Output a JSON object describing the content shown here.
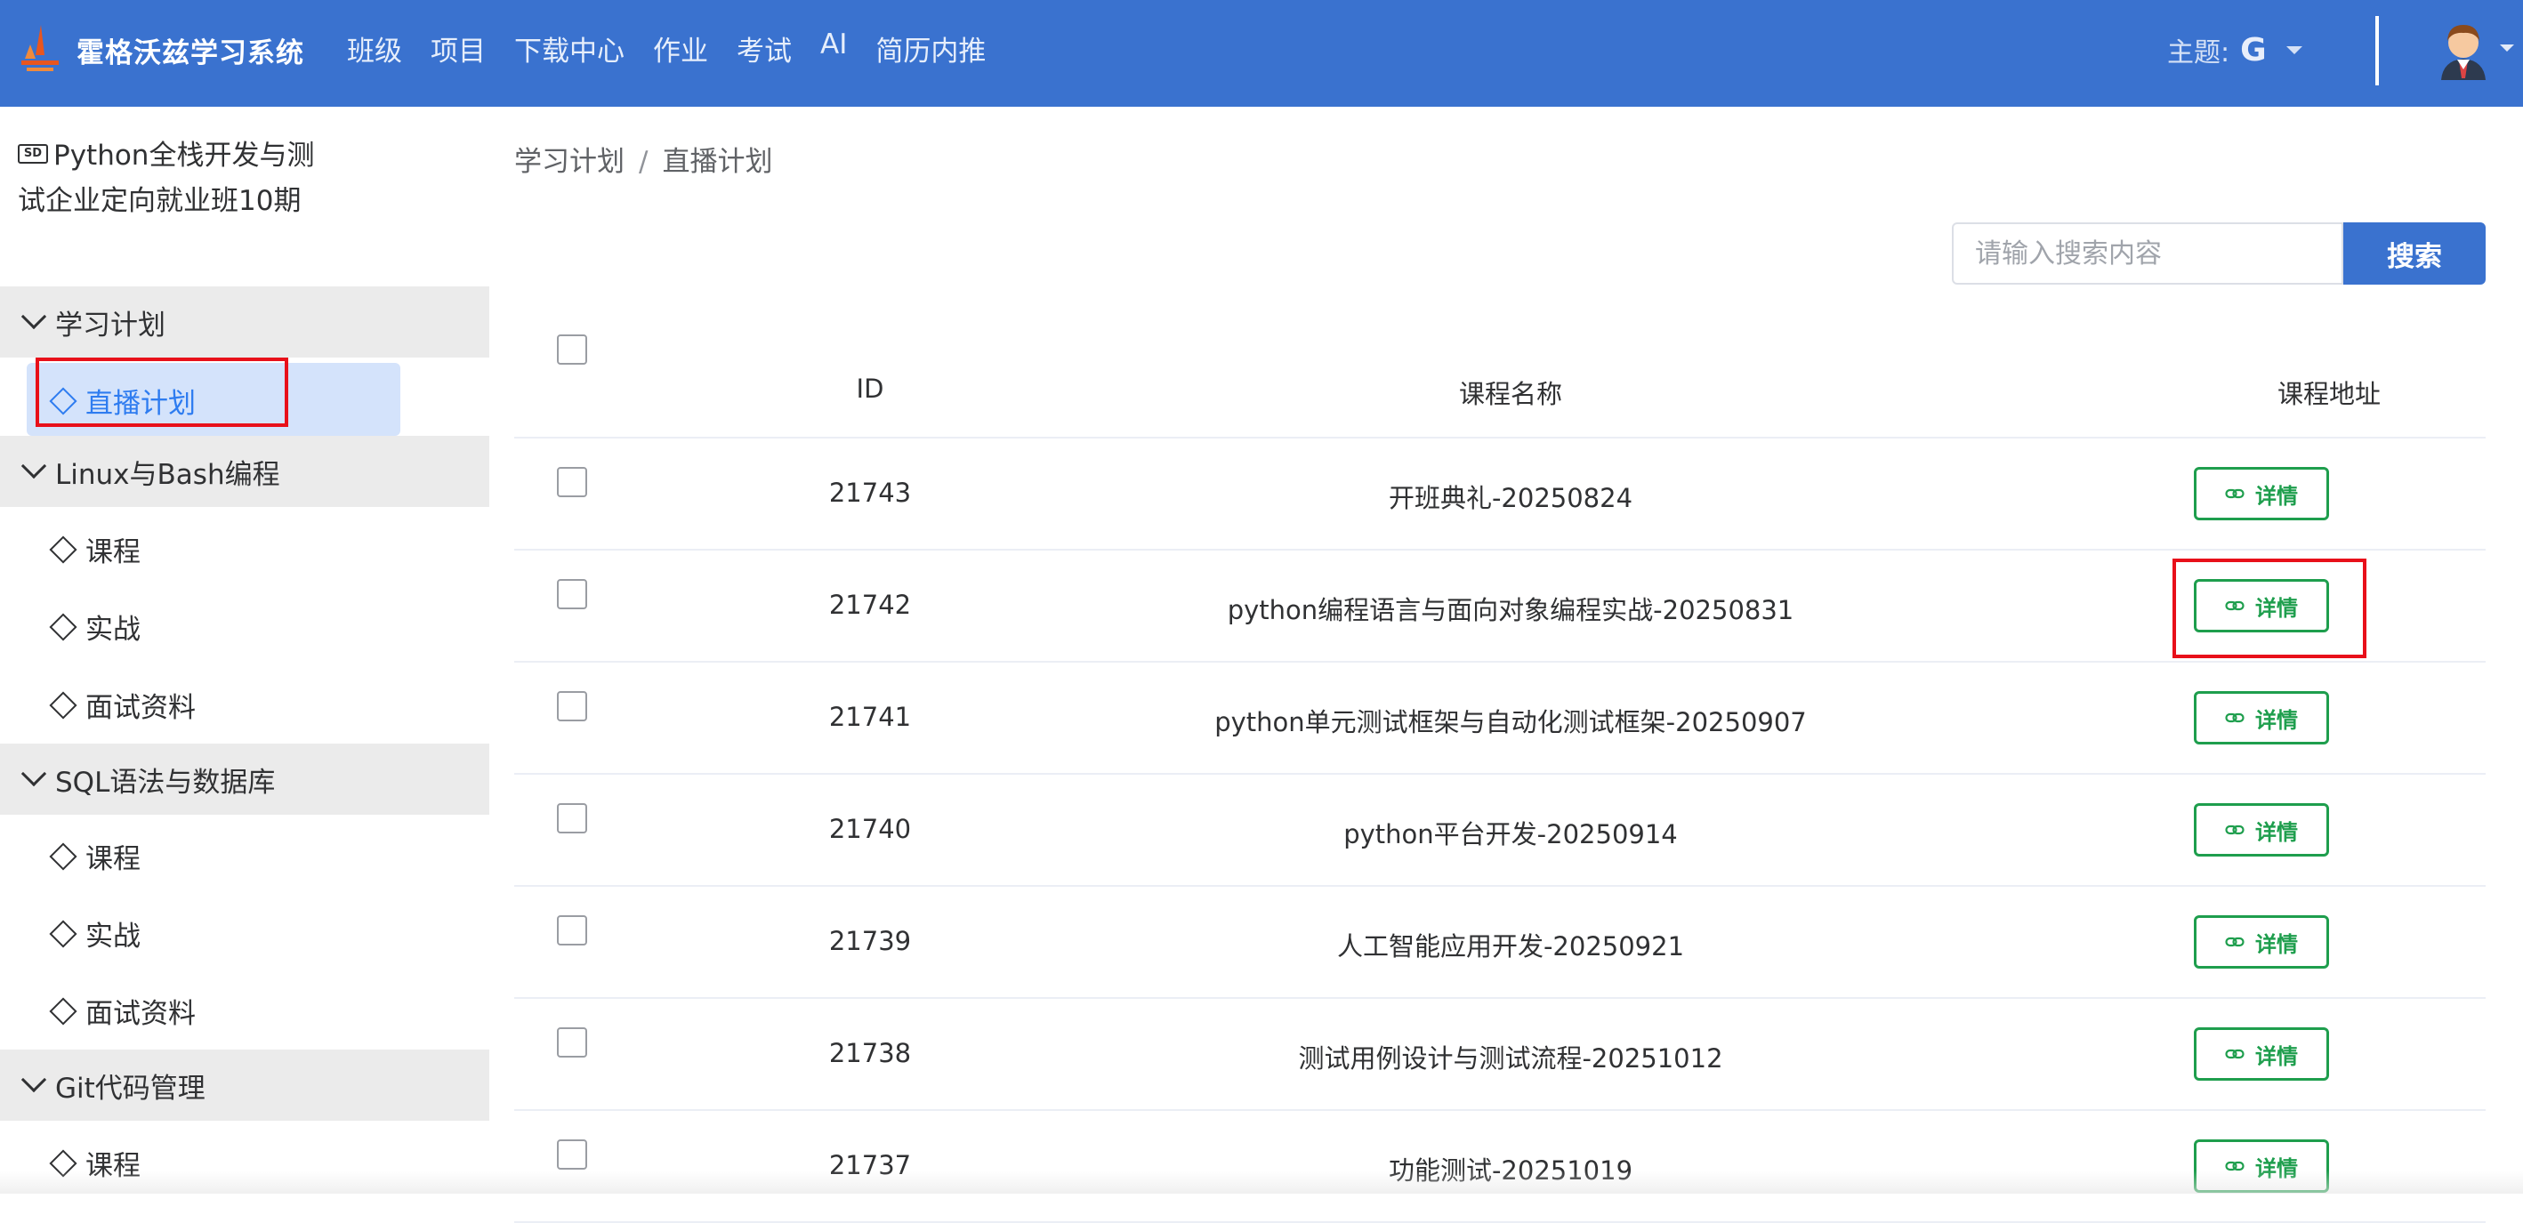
{
  "header": {
    "brand": "霍格沃兹学习系统",
    "nav": [
      "班级",
      "项目",
      "下载中心",
      "作业",
      "考试",
      "AI",
      "简历内推"
    ],
    "theme_label": "主题:",
    "theme_value": "G"
  },
  "sidebar": {
    "course_badge": "SD",
    "course_title": "Python全栈开发与测试企业定向就业班10期",
    "groups": [
      {
        "label": "学习计划",
        "items": [
          "直播计划"
        ]
      },
      {
        "label": "Linux与Bash编程",
        "items": [
          "课程",
          "实战",
          "面试资料"
        ]
      },
      {
        "label": "SQL语法与数据库",
        "items": [
          "课程",
          "实战",
          "面试资料"
        ]
      },
      {
        "label": "Git代码管理",
        "items": [
          "课程"
        ]
      }
    ]
  },
  "breadcrumb": {
    "parent": "学习计划",
    "separator": "/",
    "current": "直播计划"
  },
  "search": {
    "placeholder": "请输入搜索内容",
    "button": "搜索"
  },
  "table": {
    "headers": {
      "id": "ID",
      "name": "课程名称",
      "url": "课程地址"
    },
    "detail_label": "详情",
    "rows": [
      {
        "id": "21743",
        "name": "开班典礼-20250824"
      },
      {
        "id": "21742",
        "name": "python编程语言与面向对象编程实战-20250831"
      },
      {
        "id": "21741",
        "name": "python单元测试框架与自动化测试框架-20250907"
      },
      {
        "id": "21740",
        "name": "python平台开发-20250914"
      },
      {
        "id": "21739",
        "name": "人工智能应用开发-20250921"
      },
      {
        "id": "21738",
        "name": "测试用例设计与测试流程-20251012"
      },
      {
        "id": "21737",
        "name": "功能测试-20251019"
      }
    ]
  },
  "colors": {
    "header": "#3a72cf",
    "active": "#2e7cf0",
    "detail": "#1e9e4d",
    "highlight": "#e8101a"
  }
}
